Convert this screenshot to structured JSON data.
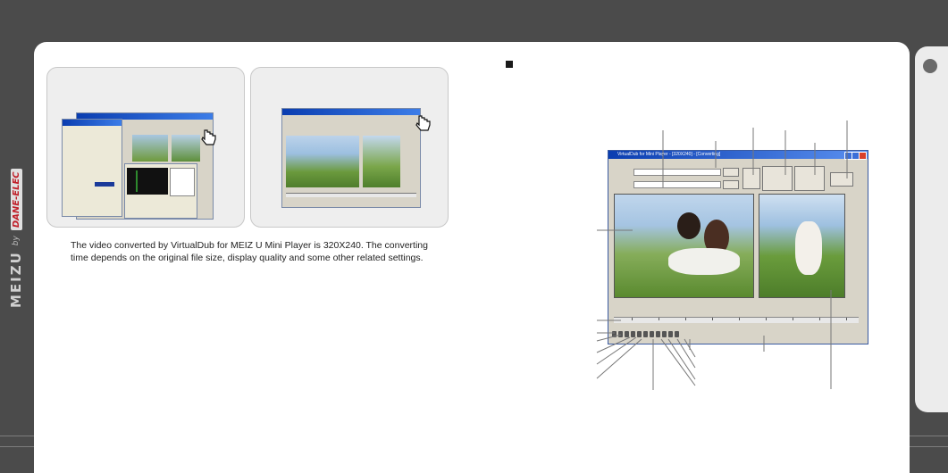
{
  "caption": {
    "line1": "The video converted by VirtualDub for MEIZ U Mini Player is 320X240. The converting",
    "line2": "time depends on the original file size, display quality and some other related settings."
  },
  "brand": {
    "name": "MEIZU",
    "by": "by",
    "partner": "DANE-ELEC"
  },
  "app_window": {
    "title": "VirtualDub for Mini Player - [320X240] - [Converting]"
  },
  "colors": {
    "frame": "#4b4b4b",
    "page": "#ffffff",
    "accent_titlebar": "#0a3db0",
    "brand_red": "#c0202a"
  },
  "icons": {
    "hand_cursor_1": "pointer-hand-icon",
    "hand_cursor_2": "pointer-hand-icon",
    "bullet": "square-bullet-icon"
  }
}
